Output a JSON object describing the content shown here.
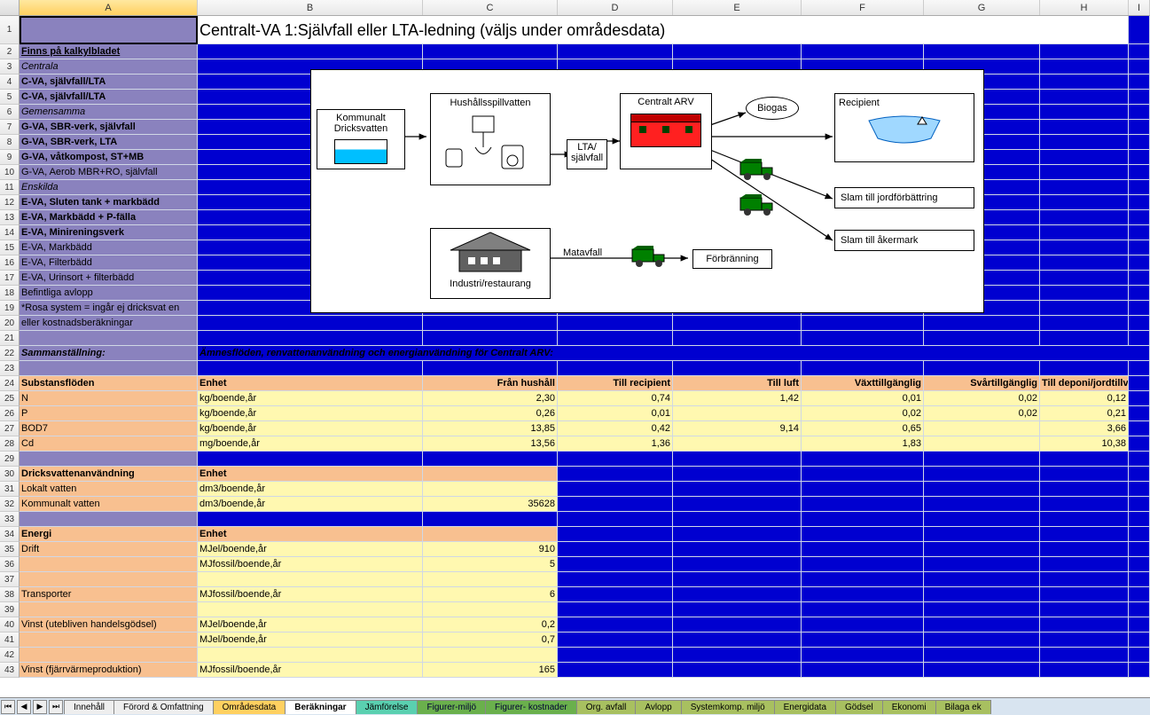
{
  "columns": [
    "A",
    "B",
    "C",
    "D",
    "E",
    "F",
    "G",
    "H",
    "I"
  ],
  "title_row": "Centralt-VA 1:Självfall eller LTA-ledning (väljs under områdesdata)",
  "colA": {
    "r2": "Finns på kalkylbladet",
    "r3": "Centrala",
    "r4": "C-VA, självfall/LTA",
    "r5": "C-VA, självfall/LTA",
    "r6": "Gemensamma",
    "r7": "G-VA, SBR-verk, självfall",
    "r8": "G-VA, SBR-verk, LTA",
    "r9": "G-VA, våtkompost, ST+MB",
    "r10": "G-VA, Aerob MBR+RO, självfall",
    "r11": "Enskilda",
    "r12": "E-VA, Sluten tank + markbädd",
    "r13": "E-VA, Markbädd + P-fälla",
    "r14": "E-VA, Minireningsverk",
    "r15": "E-VA, Markbädd",
    "r16": "E-VA, Filterbädd",
    "r17": "E-VA, Urinsort + filterbädd",
    "r18": "Befintliga avlopp",
    "r19": "*Rosa system = ingår ej dricksvat en",
    "r20": "eller kostnadsberäkningar",
    "r22": "Sammanställning:"
  },
  "subtitle_b22": "Ämnesflöden, renvattenanvändning och energianvändning för Centralt ARV:",
  "headers24": {
    "A": "Substansflöden",
    "B": "Enhet",
    "C": "Från hushåll",
    "D": "Till recipient",
    "E": "Till luft",
    "F": "Växttillgänglig",
    "G": "Svårtillgänglig",
    "H": "Till deponi/jordtillv."
  },
  "rows_substans": [
    {
      "A": "N",
      "B": "kg/boende,år",
      "C": "2,30",
      "D": "0,74",
      "E": "1,42",
      "F": "0,01",
      "G": "0,02",
      "H": "0,12"
    },
    {
      "A": "P",
      "B": "kg/boende,år",
      "C": "0,26",
      "D": "0,01",
      "E": "",
      "F": "0,02",
      "G": "0,02",
      "H": "0,21"
    },
    {
      "A": "BOD7",
      "B": "kg/boende,år",
      "C": "13,85",
      "D": "0,42",
      "E": "9,14",
      "F": "0,65",
      "G": "",
      "H": "3,66"
    },
    {
      "A": "Cd",
      "B": "mg/boende,år",
      "C": "13,56",
      "D": "1,36",
      "E": "",
      "F": "1,83",
      "G": "",
      "H": "10,38"
    }
  ],
  "headers30": {
    "A": "Dricksvattenanvändning",
    "B": "Enhet"
  },
  "rows_water": [
    {
      "A": "Lokalt vatten",
      "B": "dm3/boende,år",
      "C": ""
    },
    {
      "A": "Kommunalt vatten",
      "B": "dm3/boende,år",
      "C": "35628"
    }
  ],
  "headers34": {
    "A": "Energi",
    "B": "Enhet"
  },
  "rows_energy": [
    {
      "A": "Drift",
      "B": "MJel/boende,år",
      "C": "910"
    },
    {
      "A": "",
      "B": "MJfossil/boende,år",
      "C": "5"
    },
    {
      "A": "",
      "B": "",
      "C": ""
    },
    {
      "A": "Transporter",
      "B": "MJfossil/boende,år",
      "C": "6"
    },
    {
      "A": "",
      "B": "",
      "C": ""
    },
    {
      "A": "Vinst (utebliven handelsgödsel)",
      "B": "MJel/boende,år",
      "C": "0,2"
    },
    {
      "A": "",
      "B": "MJel/boende,år",
      "C": "0,7"
    },
    {
      "A": "",
      "B": "",
      "C": ""
    },
    {
      "A": "Vinst (fjärrvärmeproduktion)",
      "B": "MJfossil/boende,år",
      "C": "165"
    }
  ],
  "diagram": {
    "kommunalt": "Kommunalt Dricksvatten",
    "hushall": "Hushållsspillvatten",
    "lta": "LTA/ självfall",
    "centralt": "Centralt ARV",
    "biogas": "Biogas",
    "recipient": "Recipient",
    "slam1": "Slam till jordförbättring",
    "slam2": "Slam till åkermark",
    "matavfall": "Matavfall",
    "forbranning": "Förbränning",
    "industri": "Industri/restaurang"
  },
  "tabs": [
    {
      "label": "Innehåll",
      "class": ""
    },
    {
      "label": "Förord & Omfattning",
      "class": ""
    },
    {
      "label": "Områdesdata",
      "class": "yellow"
    },
    {
      "label": "Beräkningar",
      "class": "active"
    },
    {
      "label": "Jämförelse",
      "class": "teal"
    },
    {
      "label": "Figurer-miljö",
      "class": "green"
    },
    {
      "label": "Figurer- kostnader",
      "class": "green"
    },
    {
      "label": "Org. avfall",
      "class": "olive"
    },
    {
      "label": "Avlopp",
      "class": "olive"
    },
    {
      "label": "Systemkomp. miljö",
      "class": "olive"
    },
    {
      "label": "Energidata",
      "class": "olive"
    },
    {
      "label": "Gödsel",
      "class": "olive"
    },
    {
      "label": "Ekonomi",
      "class": "olive"
    },
    {
      "label": "Bilaga ek",
      "class": "olive"
    }
  ]
}
